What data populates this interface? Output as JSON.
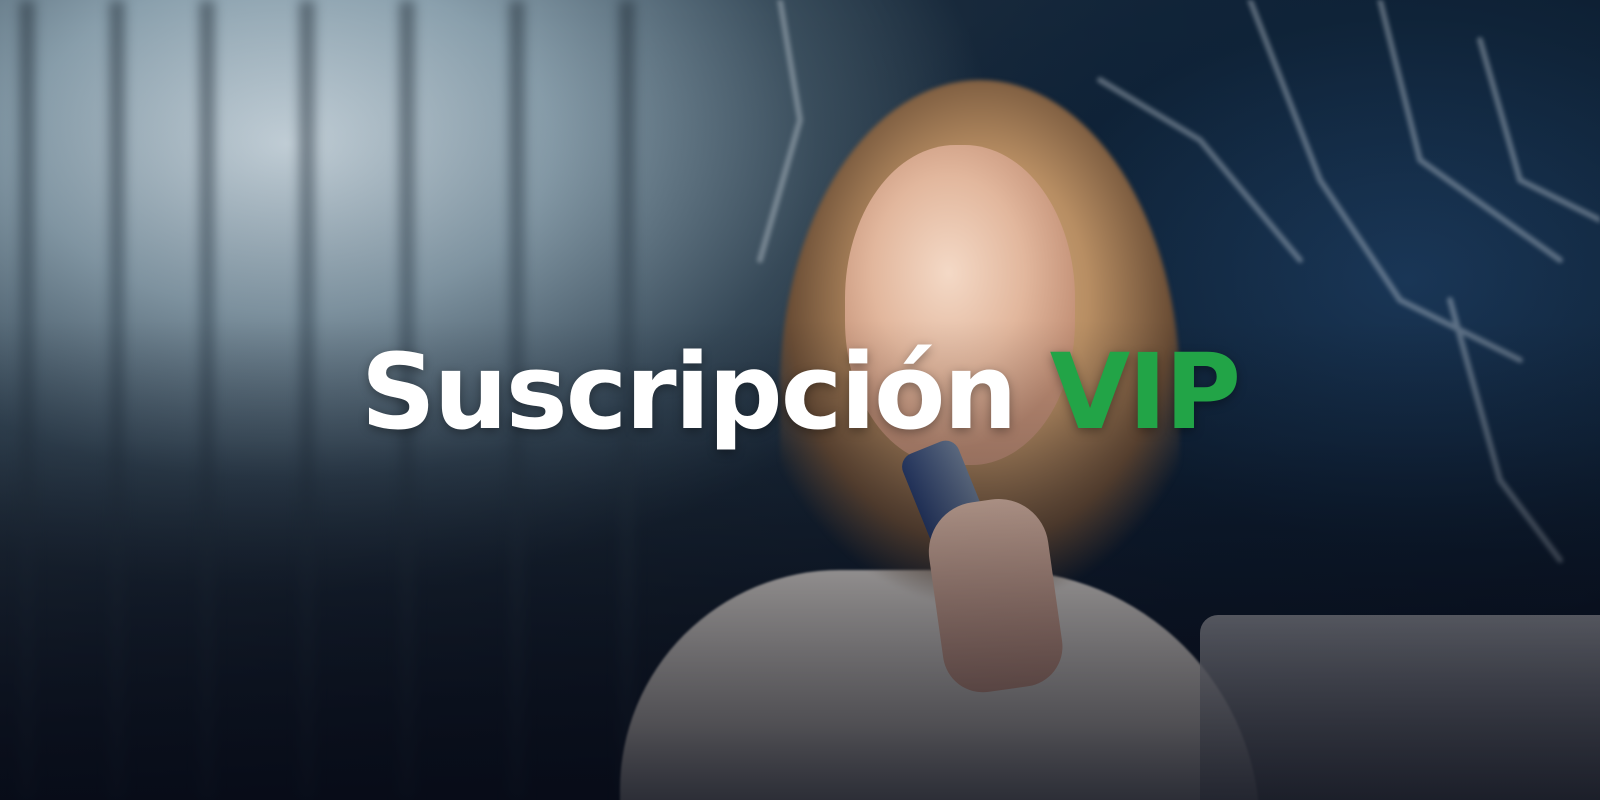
{
  "headline": {
    "main": "Suscripción",
    "accent": "VIP"
  },
  "colors": {
    "headline_main": "#ffffff",
    "headline_accent": "#22a447"
  },
  "background": {
    "description_icon": "woman-with-phone-photo"
  }
}
